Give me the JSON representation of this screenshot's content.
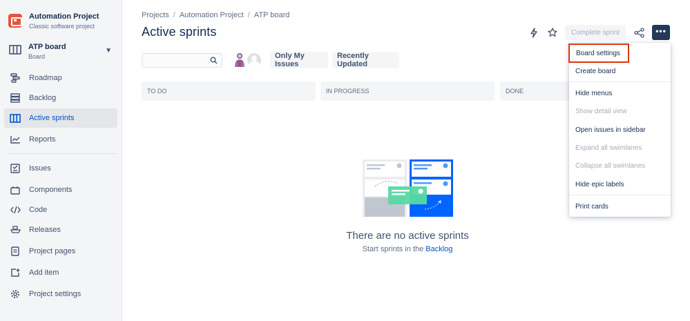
{
  "project": {
    "name": "Automation Project",
    "type": "Classic software project"
  },
  "board": {
    "name": "ATP board",
    "sub": "Board"
  },
  "nav": {
    "roadmap": "Roadmap",
    "backlog": "Backlog",
    "active_sprints": "Active sprints",
    "reports": "Reports",
    "issues": "Issues",
    "components": "Components",
    "code": "Code",
    "releases": "Releases",
    "project_pages": "Project pages",
    "add_item": "Add item",
    "project_settings": "Project settings"
  },
  "breadcrumb": {
    "projects": "Projects",
    "project": "Automation Project",
    "board": "ATP board",
    "sep": "/"
  },
  "title": "Active sprints",
  "toolbar": {
    "complete_sprint": "Complete sprint",
    "more": "•••"
  },
  "filters": {
    "only_my_issues": "Only My Issues",
    "recently_updated": "Recently Updated"
  },
  "columns": {
    "todo": "TO DO",
    "in_progress": "IN PROGRESS",
    "done": "DONE"
  },
  "empty": {
    "title": "There are no active sprints",
    "sub_prefix": "Start sprints in the",
    "sub_link": "Backlog"
  },
  "menu": {
    "board_settings": "Board settings",
    "create_board": "Create board",
    "hide_menus": "Hide menus",
    "show_detail_view": "Show detail view",
    "open_issues_sidebar": "Open issues in sidebar",
    "expand_swimlanes": "Expand all swimlanes",
    "collapse_swimlanes": "Collapse all swimlanes",
    "hide_epic_labels": "Hide epic labels",
    "print_cards": "Print cards"
  },
  "colors": {
    "accent": "#0052CC",
    "highlight": "#DE350B",
    "project_icon": "#E5543C"
  }
}
